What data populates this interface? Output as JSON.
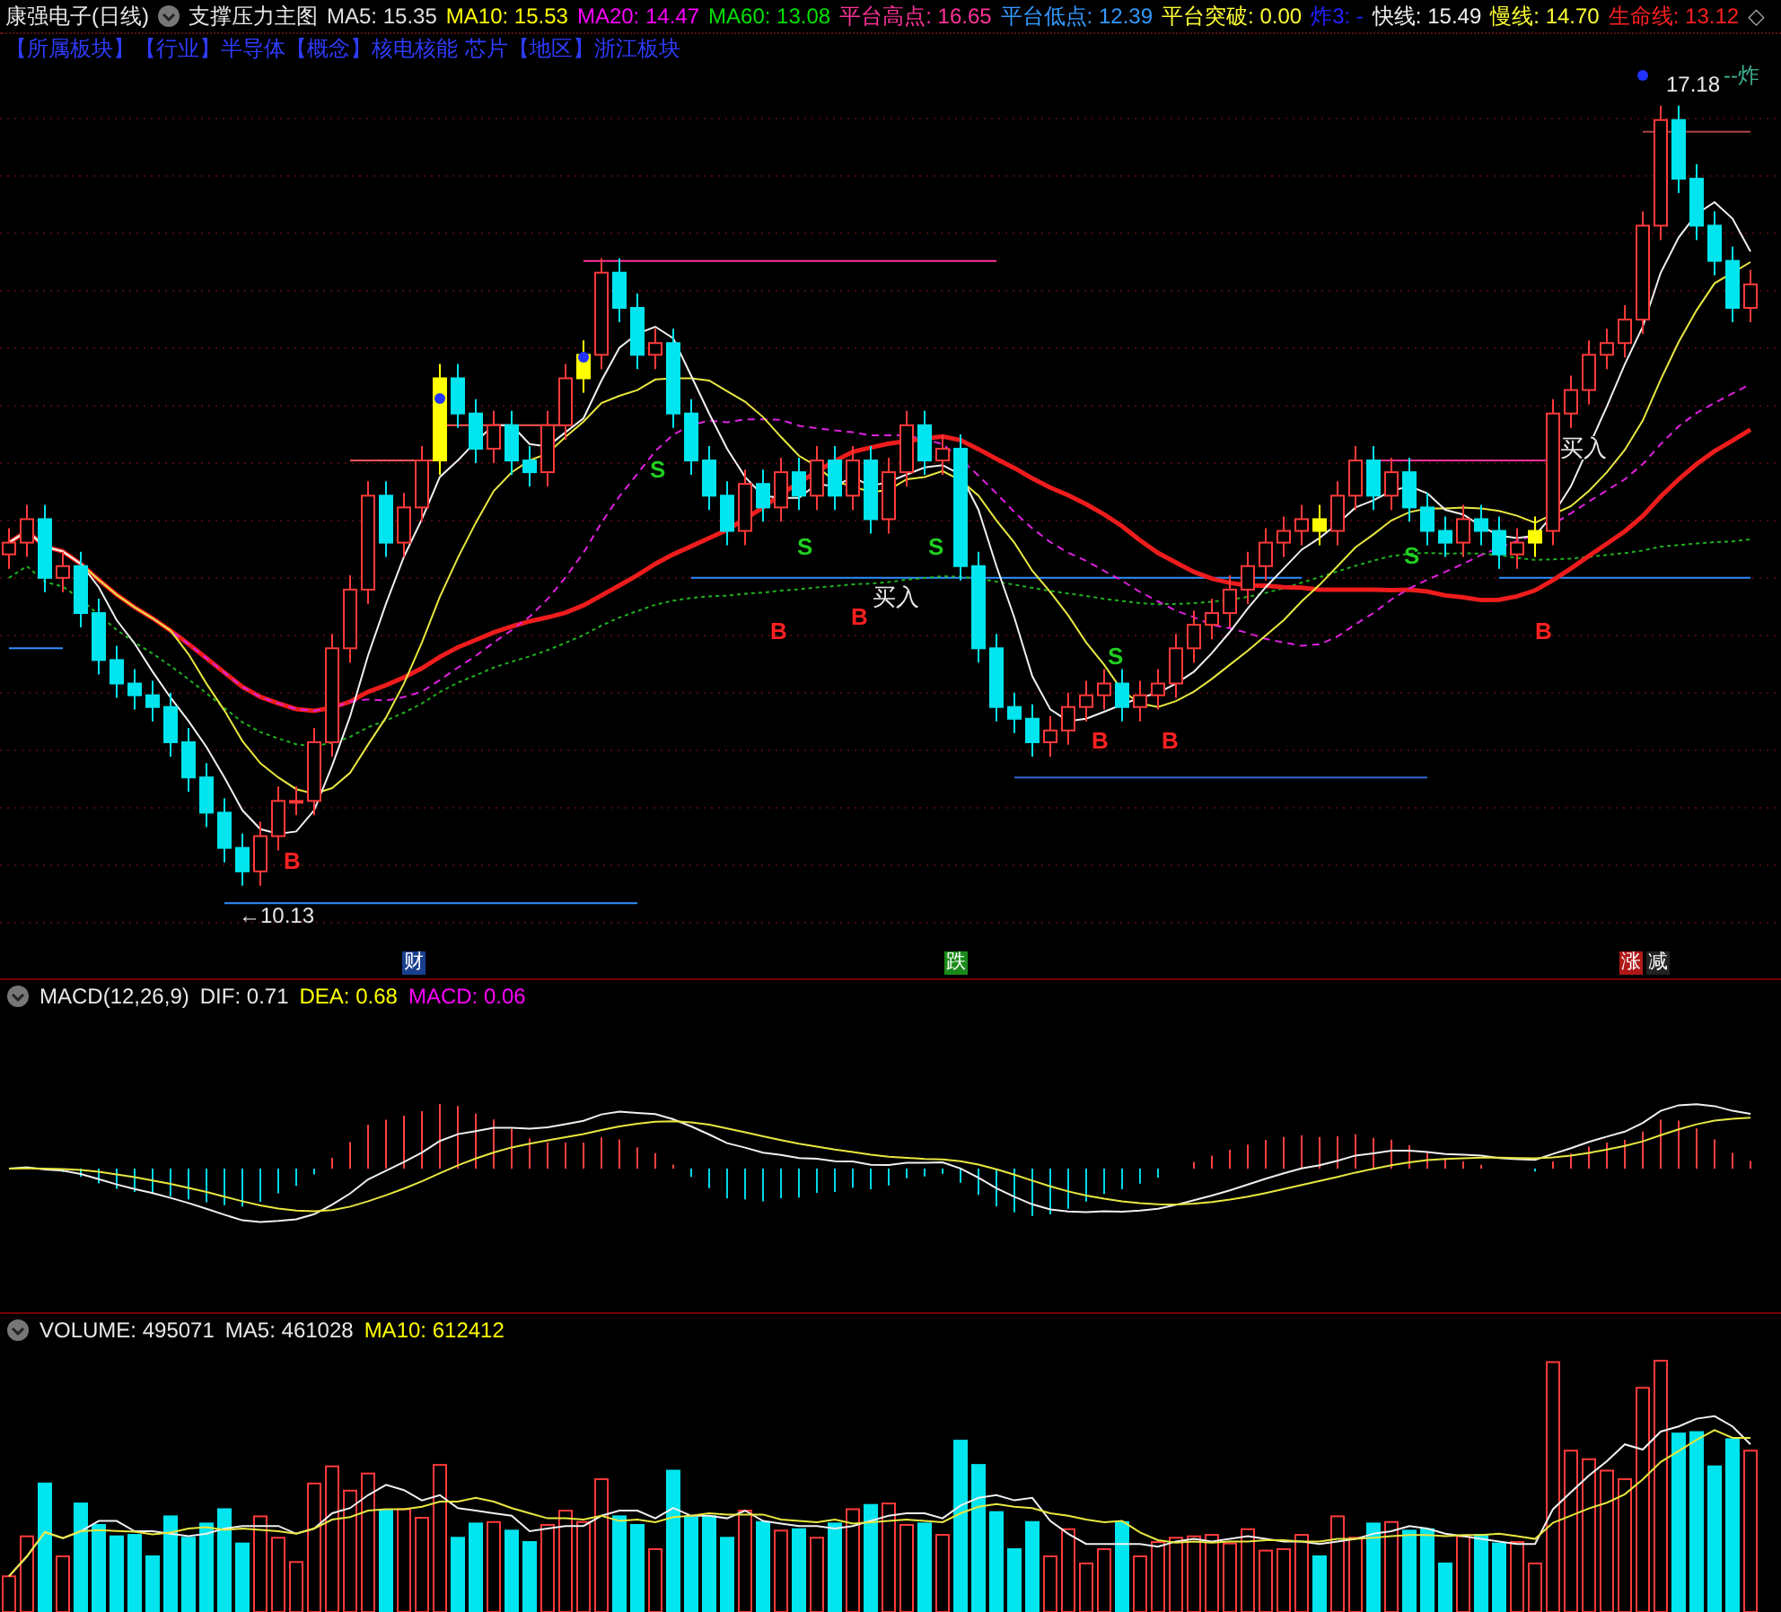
{
  "header": {
    "stock_name": "康强电子(日线)",
    "indicator_name": "支撑压力主图",
    "values": [
      {
        "label": "MA5:",
        "value": "15.35",
        "color": "#e0e0e0"
      },
      {
        "label": "MA10:",
        "value": "15.53",
        "color": "#ffff00"
      },
      {
        "label": "MA20:",
        "value": "14.47",
        "color": "#ff00ff"
      },
      {
        "label": "MA60:",
        "value": "13.08",
        "color": "#00e000"
      },
      {
        "label": "平台高点:",
        "value": "16.65",
        "color": "#ff3399"
      },
      {
        "label": "平台低点:",
        "value": "12.39",
        "color": "#3399ff"
      },
      {
        "label": "平台突破:",
        "value": "0.00",
        "color": "#ffff33"
      },
      {
        "label": "炸3:",
        "value": "-",
        "color": "#2222ff"
      },
      {
        "label": "快线:",
        "value": "15.49",
        "color": "#f0f0f0"
      },
      {
        "label": "慢线:",
        "value": "14.70",
        "color": "#ffff33"
      },
      {
        "label": "生命线:",
        "value": "13.12",
        "color": "#ff2020"
      }
    ],
    "symbol": "◇"
  },
  "info_line": [
    "【所属板块】",
    "【行业】",
    "半导体",
    "【概念】",
    "核电核能",
    "芯片",
    "【地区】",
    "浙江板块"
  ],
  "main_chart": {
    "price_labels": [
      {
        "text": "17.18",
        "kind": "high"
      },
      {
        "text": "←10.13",
        "kind": "low"
      },
      {
        "text": "--炸",
        "kind": "tag"
      }
    ],
    "signals": [
      {
        "text": "B",
        "kind": "buy"
      },
      {
        "text": "S",
        "kind": "sell"
      },
      {
        "text": "B",
        "kind": "buy"
      },
      {
        "text": "S",
        "kind": "sell"
      },
      {
        "text": "B",
        "kind": "buy"
      },
      {
        "text": "S",
        "kind": "sell"
      },
      {
        "text": "买入",
        "kind": "entry"
      },
      {
        "text": "S",
        "kind": "sell"
      },
      {
        "text": "B",
        "kind": "buy"
      },
      {
        "text": "B",
        "kind": "buy"
      },
      {
        "text": "S",
        "kind": "sell"
      },
      {
        "text": "B",
        "kind": "buy"
      },
      {
        "text": "买入",
        "kind": "entry"
      }
    ]
  },
  "event_markers": [
    {
      "text": "财",
      "color": "#1a3f8f"
    },
    {
      "text": "跌",
      "color": "#1a8a1a"
    },
    {
      "text": "涨",
      "color": "#b01818"
    },
    {
      "text": "减",
      "color": "#222222"
    }
  ],
  "macd": {
    "name": "MACD(12,26,9)",
    "values": [
      {
        "label": "DIF:",
        "value": "0.71",
        "color": "#e8e8e8"
      },
      {
        "label": "DEA:",
        "value": "0.68",
        "color": "#ffff00"
      },
      {
        "label": "MACD:",
        "value": "0.06",
        "color": "#ff00ff"
      }
    ]
  },
  "volume": {
    "values": [
      {
        "label": "VOLUME:",
        "value": "495071",
        "color": "#e8e8e8"
      },
      {
        "label": "MA5:",
        "value": "461028",
        "color": "#e8e8e8"
      },
      {
        "label": "MA10:",
        "value": "612412",
        "color": "#ffff00"
      }
    ]
  }
}
